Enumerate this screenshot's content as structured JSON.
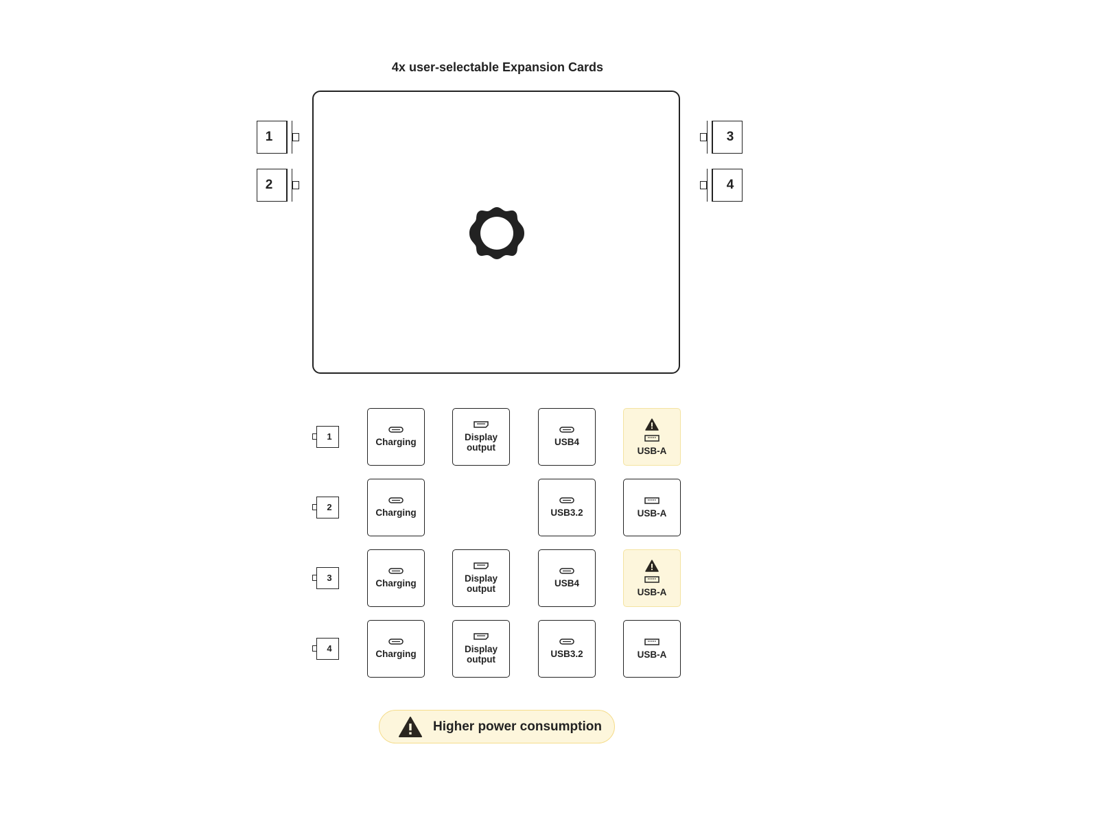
{
  "title": "4x user-selectable Expansion Cards",
  "laptop": {
    "logo_icon": "framework-gear-icon"
  },
  "side_cards": [
    {
      "number": "1",
      "side": "left"
    },
    {
      "number": "2",
      "side": "left"
    },
    {
      "number": "3",
      "side": "right"
    },
    {
      "number": "4",
      "side": "right"
    }
  ],
  "rows": [
    {
      "slot": "1",
      "ports": [
        {
          "label": "Charging",
          "icon": "usb-c-icon",
          "warning": false
        },
        {
          "label": "Display output",
          "icon": "displayport-icon",
          "warning": false
        },
        {
          "label": "USB4",
          "icon": "usb-c-icon",
          "warning": false
        },
        {
          "label": "USB-A",
          "icon": "usb-a-icon",
          "warning": true
        }
      ]
    },
    {
      "slot": "2",
      "ports": [
        {
          "label": "Charging",
          "icon": "usb-c-icon",
          "warning": false
        },
        null,
        {
          "label": "USB3.2",
          "icon": "usb-c-icon",
          "warning": false
        },
        {
          "label": "USB-A",
          "icon": "usb-a-icon",
          "warning": false
        }
      ]
    },
    {
      "slot": "3",
      "ports": [
        {
          "label": "Charging",
          "icon": "usb-c-icon",
          "warning": false
        },
        {
          "label": "Display output",
          "icon": "displayport-icon",
          "warning": false
        },
        {
          "label": "USB4",
          "icon": "usb-c-icon",
          "warning": false
        },
        {
          "label": "USB-A",
          "icon": "usb-a-icon",
          "warning": true
        }
      ]
    },
    {
      "slot": "4",
      "ports": [
        {
          "label": "Charging",
          "icon": "usb-c-icon",
          "warning": false
        },
        {
          "label": "Display output",
          "icon": "displayport-icon",
          "warning": false
        },
        {
          "label": "USB3.2",
          "icon": "usb-c-icon",
          "warning": false
        },
        {
          "label": "USB-A",
          "icon": "usb-a-icon",
          "warning": false
        }
      ]
    }
  ],
  "legend": {
    "icon": "warning-icon",
    "text": "Higher power consumption"
  },
  "colors": {
    "warning_bg": "#fdf6dc",
    "warning_border": "#f5dc8a",
    "ink": "#222222"
  }
}
